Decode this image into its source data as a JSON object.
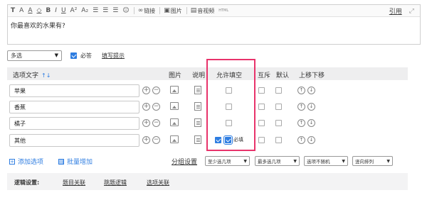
{
  "editor": {
    "toolbar": {
      "link_label": "链接",
      "image_label": "图片",
      "audio_video_label": "音视频",
      "html_label": "HTML",
      "quote_label": "引用"
    },
    "question_text": "你最喜欢的水果有?"
  },
  "type_bar": {
    "type_value": "多选",
    "required_label": "必答",
    "required_checked": true,
    "hint_link": "填写提示"
  },
  "table": {
    "headers": {
      "option_text": "选项文字",
      "image": "图片",
      "description": "说明",
      "allow_fill": "允许填空",
      "mutex": "互斥",
      "default": "默认",
      "move": "上移下移"
    },
    "rows": [
      {
        "label": "苹果",
        "fill_checked": false,
        "must_shown": false
      },
      {
        "label": "香蕉",
        "fill_checked": false,
        "must_shown": false
      },
      {
        "label": "橘子",
        "fill_checked": false,
        "must_shown": false
      },
      {
        "label": "其他",
        "fill_checked": true,
        "must_checked": true,
        "must_label": "必填"
      }
    ]
  },
  "actions": {
    "add_option": "添加选项",
    "batch_add": "批量增加",
    "group_settings": "分组设置",
    "min_select": "至少选几项",
    "max_select": "最多选几项",
    "random_order": "选项不随机",
    "layout": "竖向排列"
  },
  "logic": {
    "label": "逻辑设置:",
    "links": [
      "题目关联",
      "跳题逻辑",
      "选项关联"
    ]
  },
  "colors": {
    "accent": "#2e7de1",
    "highlight": "#e8336b"
  }
}
